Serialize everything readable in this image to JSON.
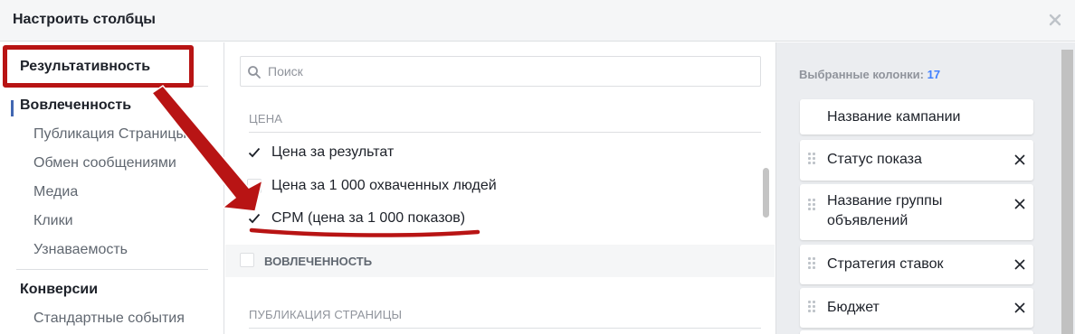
{
  "dialog": {
    "title": "Настроить столбцы"
  },
  "left_nav": {
    "groups": [
      {
        "label": "Результативность",
        "items": []
      },
      {
        "label": "Вовлеченность",
        "items": [
          "Публикация Страницы",
          "Обмен сообщениями",
          "Медиа",
          "Клики",
          "Узнаваемость"
        ]
      },
      {
        "label": "Конверсии",
        "items": [
          "Стандартные события"
        ]
      }
    ]
  },
  "search": {
    "placeholder": "Поиск",
    "value": ""
  },
  "sections": {
    "price": {
      "label": "ЦЕНА",
      "options": [
        {
          "label": "Цена за результат",
          "checked": true
        },
        {
          "label": "Цена за 1 000 охваченных людей",
          "checked": false
        },
        {
          "label": "CPM (цена за 1 000 показов)",
          "checked": true
        }
      ]
    },
    "engagement_group": {
      "label": "ВОВЛЕЧЕННОСТЬ",
      "checked": false
    },
    "page_post": {
      "label": "ПУБЛИКАЦИЯ СТРАНИЦЫ"
    }
  },
  "selected": {
    "title": "Выбранные колонки:",
    "count": "17",
    "items": [
      {
        "label": "Название кампании",
        "removable": false
      },
      {
        "label": "Статус показа",
        "removable": true
      },
      {
        "label": "Название группы объявлений",
        "removable": true
      },
      {
        "label": "Стратегия ставок",
        "removable": true
      },
      {
        "label": "Бюджет",
        "removable": true
      }
    ]
  },
  "colors": {
    "accent": "#4080ff",
    "annotation_red": "#b81414",
    "header_bg": "#f5f6f7",
    "panel_bg": "#ebedf0"
  },
  "icons": {
    "close": "close-icon",
    "search": "search-icon",
    "check": "checkmark-icon",
    "drag": "drag-handle-icon",
    "remove": "remove-icon",
    "annotation": "red-arrow-annotation"
  }
}
